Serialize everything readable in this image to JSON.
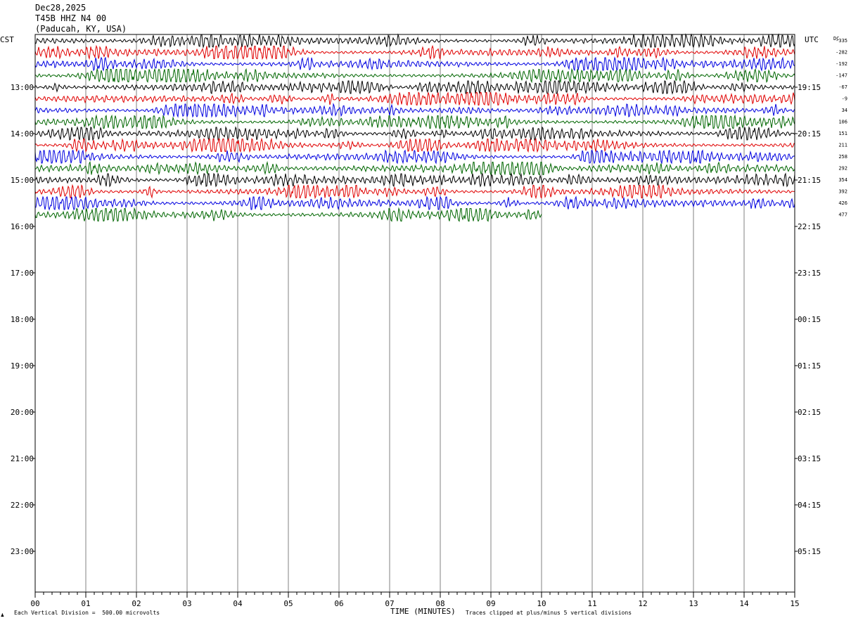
{
  "header": {
    "date": "Dec28,2025",
    "station": "T45B HHZ N4 00",
    "location": "(Paducah, KY, USA)"
  },
  "footer": {
    "scale_note": "Each Vertical Division =  500.00 microvolts",
    "clip_note": "Traces clipped at plus/minus 5 vertical divisions"
  },
  "chart_data": {
    "type": "line",
    "title": "",
    "xlabel": "TIME (MINUTES)",
    "x_ticks": [
      "00",
      "01",
      "02",
      "03",
      "04",
      "05",
      "06",
      "07",
      "08",
      "09",
      "10",
      "11",
      "12",
      "13",
      "14",
      "15"
    ],
    "xlim": [
      0,
      15
    ],
    "left_axis_label": "CST",
    "right_axis_label": "UTC",
    "dc_label": "DC",
    "left_hour_labels": [
      "13:00",
      "14:00",
      "15:00",
      "16:00",
      "17:00",
      "18:00",
      "19:00",
      "20:00",
      "21:00",
      "22:00",
      "23:00"
    ],
    "right_hour_labels": [
      "19:15",
      "20:15",
      "21:15",
      "22:15",
      "23:15",
      "00:15",
      "01:15",
      "02:15",
      "03:15",
      "04:15",
      "05:15"
    ],
    "row_minutes": 15,
    "trace_colors": [
      "#000000",
      "#e00000",
      "#0000e0",
      "#006600"
    ],
    "traces": [
      {
        "dc": "-335",
        "end_minute": 15
      },
      {
        "dc": "-282",
        "end_minute": 15
      },
      {
        "dc": "-192",
        "end_minute": 15
      },
      {
        "dc": "-147",
        "end_minute": 15
      },
      {
        "dc": "-67",
        "end_minute": 15
      },
      {
        "dc": "-9",
        "end_minute": 15
      },
      {
        "dc": "34",
        "end_minute": 15
      },
      {
        "dc": "106",
        "end_minute": 15
      },
      {
        "dc": "151",
        "end_minute": 15
      },
      {
        "dc": "211",
        "end_minute": 15
      },
      {
        "dc": "258",
        "end_minute": 15
      },
      {
        "dc": "292",
        "end_minute": 15
      },
      {
        "dc": "354",
        "end_minute": 15
      },
      {
        "dc": "392",
        "end_minute": 15
      },
      {
        "dc": "426",
        "end_minute": 15
      },
      {
        "dc": "477",
        "end_minute": 10
      }
    ]
  }
}
